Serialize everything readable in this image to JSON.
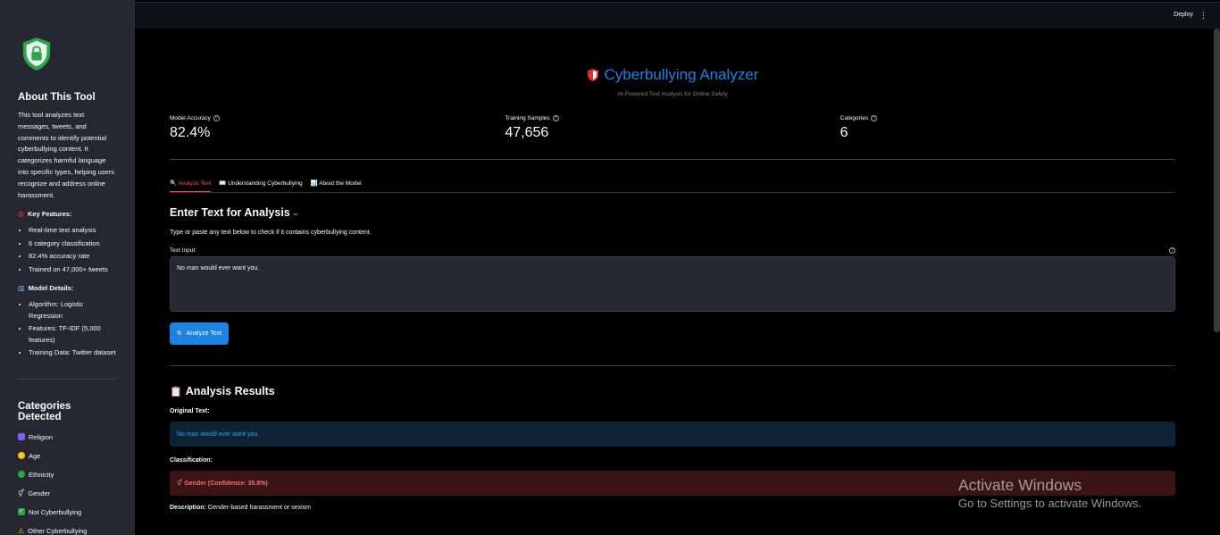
{
  "topbar": {
    "deploy": "Deploy",
    "menu": "⋮"
  },
  "sidebar": {
    "about_title": "About This Tool",
    "about_text": "This tool analyzes text messages, tweets, and comments to identify potential cyberbullying content. It categorizes harmful language into specific types, helping users recognize and address online harassment.",
    "key_features_title": "Key Features:",
    "key_features": [
      "Real-time text analysis",
      "6 category classification",
      "82.4% accuracy rate",
      "Trained on 47,000+ tweets"
    ],
    "model_details_title": "Model Details:",
    "model_details": [
      "Algorithm: Logistic Regression",
      "Features: TF-IDF (5,000 features)",
      "Training Data: Twitter dataset"
    ],
    "categories_title": "Categories Detected",
    "categories": [
      {
        "label": "Religion",
        "color": "#7b61ff"
      },
      {
        "label": "Age",
        "color": "#f5c518"
      },
      {
        "label": "Ethnicity",
        "color": "#2ea44f"
      },
      {
        "label": "Gender",
        "color": "#cccccc"
      },
      {
        "label": "Not Cyberbullying",
        "color": "#2ea44f"
      },
      {
        "label": "Other Cyberbullying",
        "color": "#f5c518"
      }
    ]
  },
  "header": {
    "title": "Cyberbullying Analyzer",
    "subtitle": "AI-Powered Text Analysis for Online Safety"
  },
  "metrics": [
    {
      "label": "Model Accuracy",
      "value": "82.4%"
    },
    {
      "label": "Training Samples",
      "value": "47,656"
    },
    {
      "label": "Categories",
      "value": "6"
    }
  ],
  "tabs": [
    {
      "label": "Analyze Text",
      "icon": "🔍"
    },
    {
      "label": "Understanding Cyberbullying",
      "icon": "📖"
    },
    {
      "label": "About the Model",
      "icon": "📊"
    }
  ],
  "analysis": {
    "heading": "Enter Text for Analysis",
    "instructions": "Type or paste any text below to check if it contains cyberbullying content.",
    "input_label": "Text Input:",
    "input_value": "No man would ever want you.",
    "button_label": "Analyze Text"
  },
  "results": {
    "heading": "Analysis Results",
    "original_label": "Original Text:",
    "original_text": "No man would ever want you.",
    "classification_label": "Classification:",
    "classification_text": "Gender (Confidence: 35.8%)",
    "description_label": "Description:",
    "description_text": "Gender-based harassment or sexism"
  },
  "watermark": {
    "line1": "Activate Windows",
    "line2": "Go to Settings to activate Windows."
  },
  "colors": {
    "accent": "#1c83e1",
    "danger": "#ff4b4b",
    "sidebar": "#262730"
  }
}
